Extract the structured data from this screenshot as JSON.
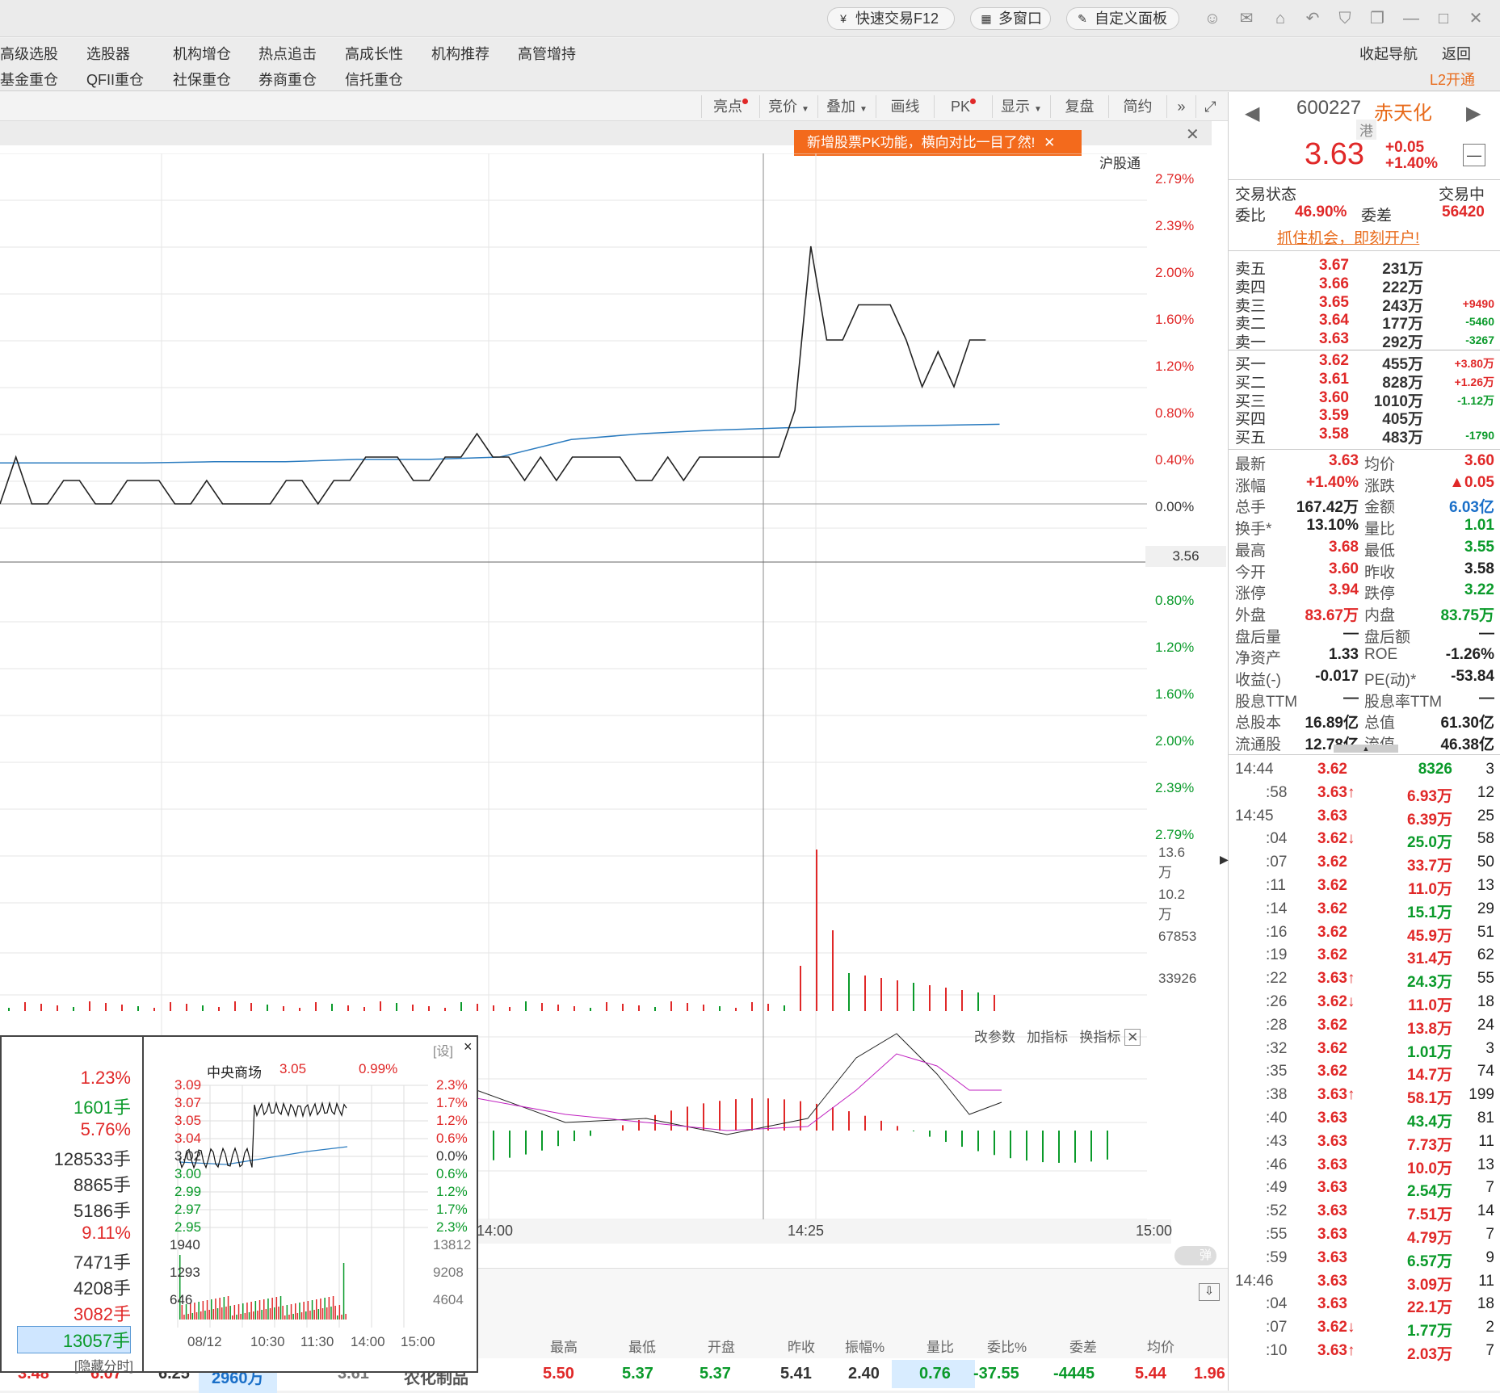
{
  "topbar": {
    "quick_trade": "快速交易F12",
    "multi_window": "多窗口",
    "custom_panel": "自定义面板"
  },
  "menu": {
    "row1": [
      "高级选股",
      "选股器",
      "机构增仓",
      "热点追击",
      "高成长性",
      "机构推荐",
      "高管增持"
    ],
    "row2": [
      "基金重仓",
      "QFII重仓",
      "社保重仓",
      "券商重仓",
      "信托重仓"
    ],
    "collapse_nav": "收起导航",
    "back": "返回",
    "l2": "L2开通"
  },
  "toolbar": {
    "items": [
      "亮点",
      "竞价",
      "叠加",
      "画线",
      "PK",
      "显示",
      "复盘",
      "简约"
    ]
  },
  "notice": "新增股票PK功能，横向对比一目了然!",
  "chart": {
    "hgt": "沪股通",
    "price_axis": [
      "2.79%",
      "2.39%",
      "2.00%",
      "1.60%",
      "1.20%",
      "0.80%",
      "0.40%",
      "0.00%"
    ],
    "price_mark": "3.56",
    "lower_axis": [
      "0.80%",
      "1.20%",
      "1.60%",
      "2.00%",
      "2.39%",
      "2.79%"
    ],
    "vol_axis": [
      "13.6万",
      "10.2万",
      "67853",
      "33926"
    ],
    "ind_tools": [
      "改参数",
      "加指标",
      "换指标"
    ],
    "time_labels": [
      "14:00",
      "14:25",
      "15:00"
    ],
    "bubble": "弹",
    "price_series": [
      0,
      0.4,
      0,
      0,
      0.2,
      0.2,
      0,
      0,
      0.2,
      0.2,
      0.2,
      0,
      0,
      0.2,
      0,
      0,
      0,
      0,
      0.2,
      0.2,
      0,
      0.2,
      0.2,
      0.4,
      0.4,
      0.4,
      0.2,
      0.2,
      0.4,
      0.4,
      0.6,
      0.4,
      0.4,
      0.2,
      0.4,
      0.2,
      0.4,
      0.4,
      0.4,
      0.4,
      0.2,
      0.2,
      0.4,
      0.2,
      0.4,
      0.4,
      0.4,
      0.4,
      0.4,
      0.4,
      0.8,
      2.2,
      1.4,
      1.4,
      1.7,
      1.7,
      1.7,
      1.4,
      1.0,
      1.3,
      1.0,
      1.4,
      1.4
    ],
    "avg_series": [
      0.35,
      0.35,
      0.35,
      0.36,
      0.36,
      0.38,
      0.38,
      0.4,
      0.55,
      0.6,
      0.63,
      0.65,
      0.66,
      0.67,
      0.68
    ]
  },
  "stock": {
    "code": "600227",
    "name": "赤天化",
    "tag": "港",
    "price": "3.63",
    "change": "+0.05",
    "pct": "+1.40%"
  },
  "status": {
    "label": "交易状态",
    "value": "交易中",
    "wb_label": "委比",
    "wb": "46.90%",
    "wc_label": "委差",
    "wc": "56420",
    "promo": "抓住机会，即刻开户!"
  },
  "asks": [
    {
      "l": "卖五",
      "p": "3.67",
      "v": "231万",
      "d": ""
    },
    {
      "l": "卖四",
      "p": "3.66",
      "v": "222万",
      "d": ""
    },
    {
      "l": "卖三",
      "p": "3.65",
      "v": "243万",
      "d": "+9490"
    },
    {
      "l": "卖二",
      "p": "3.64",
      "v": "177万",
      "d": "-5460"
    },
    {
      "l": "卖一",
      "p": "3.63",
      "v": "292万",
      "d": "-3267"
    }
  ],
  "bids": [
    {
      "l": "买一",
      "p": "3.62",
      "v": "455万",
      "d": "+3.80万"
    },
    {
      "l": "买二",
      "p": "3.61",
      "v": "828万",
      "d": "+1.26万"
    },
    {
      "l": "买三",
      "p": "3.60",
      "v": "1010万",
      "d": "-1.12万"
    },
    {
      "l": "买四",
      "p": "3.59",
      "v": "405万",
      "d": ""
    },
    {
      "l": "买五",
      "p": "3.58",
      "v": "483万",
      "d": "-1790"
    }
  ],
  "stats": [
    [
      "最新",
      "3.63",
      "均价",
      "3.60"
    ],
    [
      "涨幅",
      "+1.40%",
      "涨跌",
      "▲0.05"
    ],
    [
      "总手",
      "167.42万",
      "金额",
      "6.03亿"
    ],
    [
      "换手*",
      "13.10%",
      "量比",
      "1.01"
    ],
    [
      "最高",
      "3.68",
      "最低",
      "3.55"
    ],
    [
      "今开",
      "3.60",
      "昨收",
      "3.58"
    ],
    [
      "涨停",
      "3.94",
      "跌停",
      "3.22"
    ],
    [
      "外盘",
      "83.67万",
      "内盘",
      "83.75万"
    ],
    [
      "盘后量",
      "—",
      "盘后额",
      "—"
    ],
    [
      "净资产",
      "1.33",
      "ROE",
      "-1.26%"
    ],
    [
      "收益(-)",
      "-0.017",
      "PE(动)*",
      "-53.84"
    ],
    [
      "股息TTM",
      "—",
      "股息率TTM",
      "—"
    ],
    [
      "总股本",
      "16.89亿",
      "总值",
      "61.30亿"
    ],
    [
      "流通股",
      "12.78亿",
      "流值",
      "46.38亿"
    ]
  ],
  "ticks": [
    [
      "14:44",
      "3.62",
      "8326",
      "3"
    ],
    [
      ":58",
      "3.63↑",
      "6.93万",
      "12"
    ],
    [
      "14:45",
      "3.63",
      "6.39万",
      "25"
    ],
    [
      ":04",
      "3.62↓",
      "25.0万",
      "58"
    ],
    [
      ":07",
      "3.62",
      "33.7万",
      "50"
    ],
    [
      ":11",
      "3.62",
      "11.0万",
      "13"
    ],
    [
      ":14",
      "3.62",
      "15.1万",
      "29"
    ],
    [
      ":16",
      "3.62",
      "45.9万",
      "51"
    ],
    [
      ":19",
      "3.62",
      "31.4万",
      "62"
    ],
    [
      ":22",
      "3.63↑",
      "24.3万",
      "55"
    ],
    [
      ":26",
      "3.62↓",
      "11.0万",
      "18"
    ],
    [
      ":28",
      "3.62",
      "13.8万",
      "24"
    ],
    [
      ":32",
      "3.62",
      "1.01万",
      "3"
    ],
    [
      ":35",
      "3.62",
      "14.7万",
      "74"
    ],
    [
      ":38",
      "3.63↑",
      "58.1万",
      "199"
    ],
    [
      ":40",
      "3.63",
      "43.4万",
      "81"
    ],
    [
      ":43",
      "3.63",
      "7.73万",
      "11"
    ],
    [
      ":46",
      "3.63",
      "10.0万",
      "13"
    ],
    [
      ":49",
      "3.63",
      "2.54万",
      "7"
    ],
    [
      ":52",
      "3.63",
      "7.51万",
      "14"
    ],
    [
      ":55",
      "3.63",
      "4.79万",
      "7"
    ],
    [
      ":59",
      "3.63",
      "6.57万",
      "9"
    ],
    [
      "14:46",
      "3.63",
      "3.09万",
      "11"
    ],
    [
      ":04",
      "3.63",
      "22.1万",
      "18"
    ],
    [
      ":07",
      "3.62↓",
      "1.77万",
      "2"
    ],
    [
      ":10",
      "3.63↑",
      "2.03万",
      "7"
    ]
  ],
  "popup": {
    "set": "[设]",
    "name": "中央商场",
    "price": "3.05",
    "pct": "0.99%",
    "left_col": [
      "1.23%",
      "1601手",
      "5.76%",
      "128533手",
      "8865手",
      "5186手",
      "9.11%",
      "7471手",
      "4208手",
      "3082手",
      "13057手"
    ],
    "hide": "[隐藏分时]",
    "price_axis": [
      "3.09",
      "3.07",
      "3.05",
      "3.04",
      "3.02",
      "3.00",
      "2.99",
      "2.97",
      "2.95"
    ],
    "pct_axis": [
      "2.3%",
      "1.7%",
      "1.2%",
      "0.6%",
      "0.0%",
      "0.6%",
      "1.2%",
      "1.7%",
      "2.3%"
    ],
    "vol_left": [
      "1940",
      "1293",
      "646"
    ],
    "vol_right": [
      "13812",
      "9208",
      "4604"
    ],
    "dates": [
      "08/12",
      "10:30",
      "11:30",
      "14:00",
      "15:00"
    ]
  },
  "table": {
    "headers": [
      "最高",
      "最低",
      "开盘",
      "昨收",
      "振幅%",
      "量比",
      "委比%",
      "委差",
      "均价"
    ],
    "row": [
      "5.50",
      "5.37",
      "5.37",
      "5.41",
      "2.40",
      "0.76",
      "-37.55",
      "-4445",
      "5.44"
    ],
    "extra": "1.96",
    "name": "农化制品",
    "partial": [
      "3.48",
      "6.07",
      "6.25",
      "2960万",
      "3.61"
    ]
  }
}
